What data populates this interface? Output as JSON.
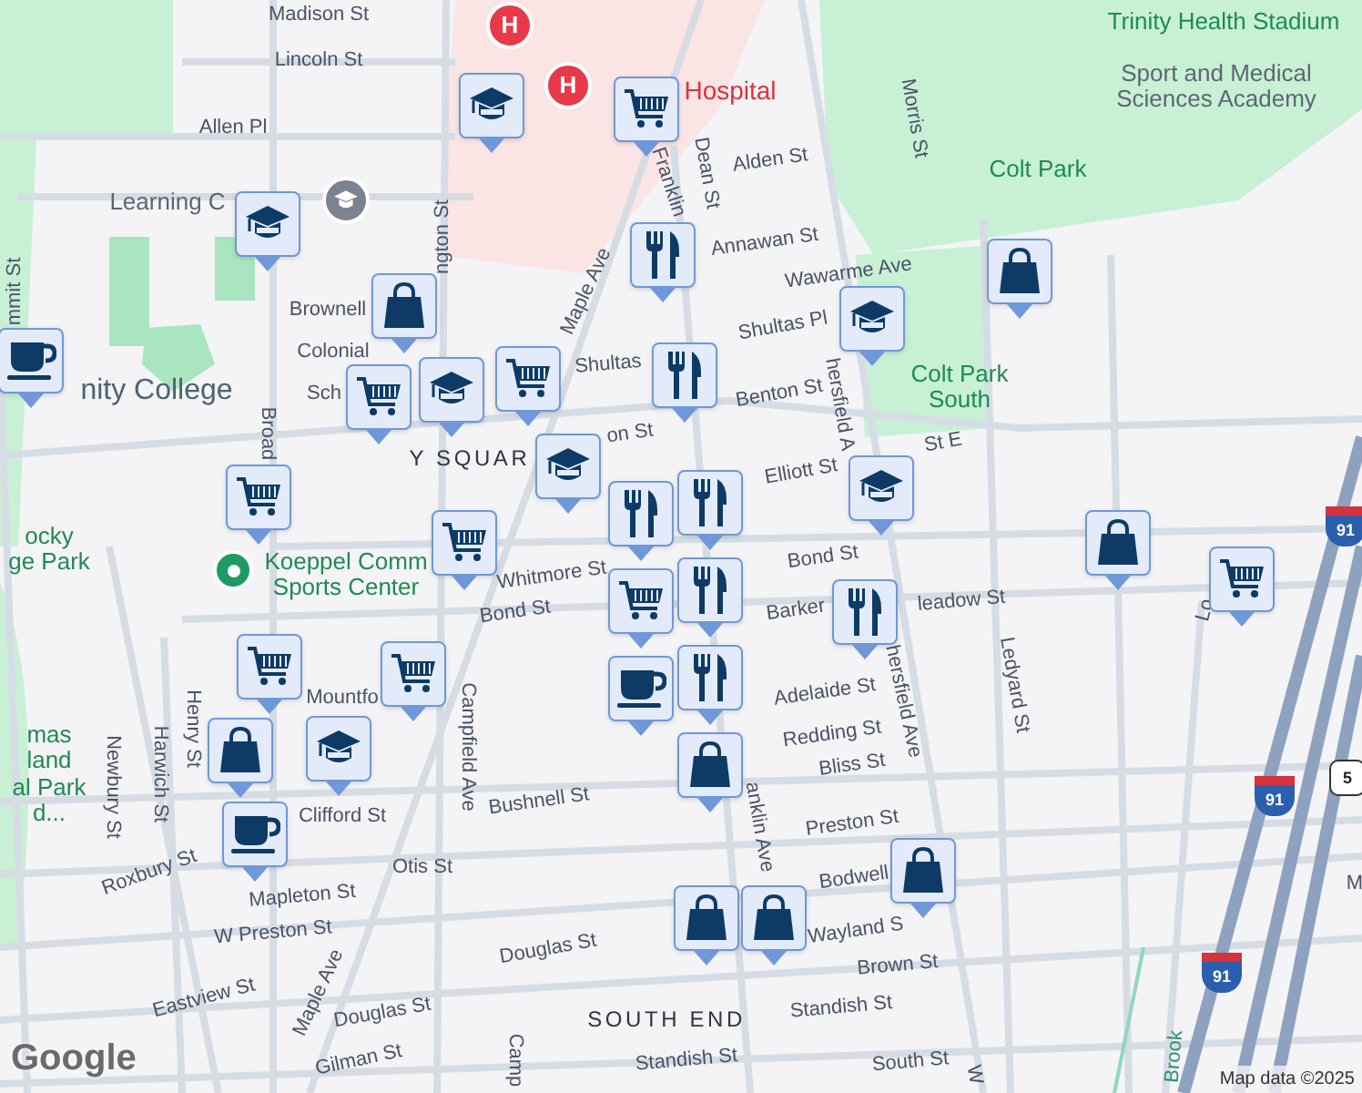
{
  "map": {
    "labels": [
      {
        "text": "Madison St",
        "kind": "street"
      },
      {
        "text": "Lincoln St",
        "kind": "street"
      },
      {
        "text": "Allen Pl",
        "kind": "street"
      },
      {
        "text": "Learning C",
        "kind": "place"
      },
      {
        "text": "Brownell",
        "kind": "street"
      },
      {
        "text": "Colonial",
        "kind": "street"
      },
      {
        "text": "nity College",
        "kind": "college"
      },
      {
        "text": "Sch",
        "kind": "street"
      },
      {
        "text": "Y SQUAR",
        "kind": "district"
      },
      {
        "text": "Shultas",
        "kind": "street"
      },
      {
        "text": "on St",
        "kind": "street"
      },
      {
        "text": "Maple Ave",
        "kind": "street"
      },
      {
        "text": "Franklin",
        "kind": "street"
      },
      {
        "text": "Dean St",
        "kind": "street"
      },
      {
        "text": "Alden St",
        "kind": "street"
      },
      {
        "text": "Annawan St",
        "kind": "street"
      },
      {
        "text": "Wawarme Ave",
        "kind": "street"
      },
      {
        "text": "Shultas Pl",
        "kind": "street"
      },
      {
        "text": "Benton St",
        "kind": "street"
      },
      {
        "text": "Elliott St",
        "kind": "street"
      },
      {
        "text": "St E",
        "kind": "street"
      },
      {
        "text": "Morris St",
        "kind": "street"
      },
      {
        "text": "Colt Park",
        "kind": "park"
      },
      {
        "text": "Colt Park\nSouth",
        "kind": "park"
      },
      {
        "text": "Trinity Health Stadium",
        "kind": "park"
      },
      {
        "text": "Hospital",
        "kind": "hospital"
      },
      {
        "text": "Sport and Medical\nSciences Academy",
        "kind": "place"
      },
      {
        "text": "hersfield A",
        "kind": "street"
      },
      {
        "text": "hersfield Ave",
        "kind": "street"
      },
      {
        "text": "Whitmore St",
        "kind": "street"
      },
      {
        "text": "Bond St",
        "kind": "street"
      },
      {
        "text": "Bond St",
        "kind": "street"
      },
      {
        "text": "Barker",
        "kind": "street"
      },
      {
        "text": "leadow St",
        "kind": "street"
      },
      {
        "text": "Koeppel Comm\nSports Center",
        "kind": "park"
      },
      {
        "text": "ocky\nge Park",
        "kind": "park"
      },
      {
        "text": "mas\nland\nal Park\nd...",
        "kind": "park"
      },
      {
        "text": "Mountfo",
        "kind": "street"
      },
      {
        "text": "Campfield Ave",
        "kind": "street"
      },
      {
        "text": "Camp",
        "kind": "street"
      },
      {
        "text": "Clifford St",
        "kind": "street"
      },
      {
        "text": "Bushnell St",
        "kind": "street"
      },
      {
        "text": "Henry St",
        "kind": "street"
      },
      {
        "text": "Harwich St",
        "kind": "street"
      },
      {
        "text": "Newbury St",
        "kind": "street"
      },
      {
        "text": "Roxbury St",
        "kind": "street"
      },
      {
        "text": "Mapleton St",
        "kind": "street"
      },
      {
        "text": "Otis St",
        "kind": "street"
      },
      {
        "text": "W Preston St",
        "kind": "street"
      },
      {
        "text": "Eastview St",
        "kind": "street"
      },
      {
        "text": "Douglas St",
        "kind": "street"
      },
      {
        "text": "Douglas St",
        "kind": "street"
      },
      {
        "text": "Gilman St",
        "kind": "street"
      },
      {
        "text": "Maple Ave",
        "kind": "street"
      },
      {
        "text": "Standish St",
        "kind": "street"
      },
      {
        "text": "Standish St",
        "kind": "street"
      },
      {
        "text": "SOUTH END",
        "kind": "district"
      },
      {
        "text": "anklin Ave",
        "kind": "street"
      },
      {
        "text": "Adelaide St",
        "kind": "street"
      },
      {
        "text": "Redding St",
        "kind": "street"
      },
      {
        "text": "Bliss St",
        "kind": "street"
      },
      {
        "text": "Preston St",
        "kind": "street"
      },
      {
        "text": "Bodwell",
        "kind": "street"
      },
      {
        "text": "Wayland S",
        "kind": "street"
      },
      {
        "text": "Brown St",
        "kind": "street"
      },
      {
        "text": "South St",
        "kind": "street"
      },
      {
        "text": "Ledyard St",
        "kind": "street"
      },
      {
        "text": "Broad",
        "kind": "street"
      },
      {
        "text": "mmit St",
        "kind": "street"
      },
      {
        "text": "ngton St",
        "kind": "street"
      },
      {
        "text": "Lo",
        "kind": "street"
      },
      {
        "text": "W",
        "kind": "street"
      },
      {
        "text": "M",
        "kind": "street"
      },
      {
        "text": "Brook",
        "kind": "water"
      }
    ],
    "shields": [
      {
        "kind": "interstate",
        "text": "91"
      },
      {
        "kind": "interstate",
        "text": "91"
      },
      {
        "kind": "interstate",
        "text": "91"
      },
      {
        "kind": "us",
        "text": "5"
      }
    ],
    "markers": [
      {
        "kind": "hospital",
        "text": "H"
      },
      {
        "kind": "hospital",
        "text": "H"
      },
      {
        "kind": "school"
      },
      {
        "kind": "park"
      }
    ],
    "pins": [
      {
        "kind": "school"
      },
      {
        "kind": "school"
      },
      {
        "kind": "school"
      },
      {
        "kind": "school"
      },
      {
        "kind": "school"
      },
      {
        "kind": "school"
      },
      {
        "kind": "school"
      },
      {
        "kind": "cart"
      },
      {
        "kind": "cart"
      },
      {
        "kind": "cart"
      },
      {
        "kind": "cart"
      },
      {
        "kind": "cart"
      },
      {
        "kind": "cart"
      },
      {
        "kind": "cart"
      },
      {
        "kind": "cart"
      },
      {
        "kind": "cart"
      },
      {
        "kind": "food"
      },
      {
        "kind": "food"
      },
      {
        "kind": "food"
      },
      {
        "kind": "food"
      },
      {
        "kind": "food"
      },
      {
        "kind": "food"
      },
      {
        "kind": "food"
      },
      {
        "kind": "bag"
      },
      {
        "kind": "bag"
      },
      {
        "kind": "bag"
      },
      {
        "kind": "bag"
      },
      {
        "kind": "bag"
      },
      {
        "kind": "bag"
      },
      {
        "kind": "bag"
      },
      {
        "kind": "bag"
      },
      {
        "kind": "coffee"
      },
      {
        "kind": "coffee"
      },
      {
        "kind": "coffee"
      }
    ],
    "logo": "Google",
    "attribution": "Map data ©2025"
  }
}
